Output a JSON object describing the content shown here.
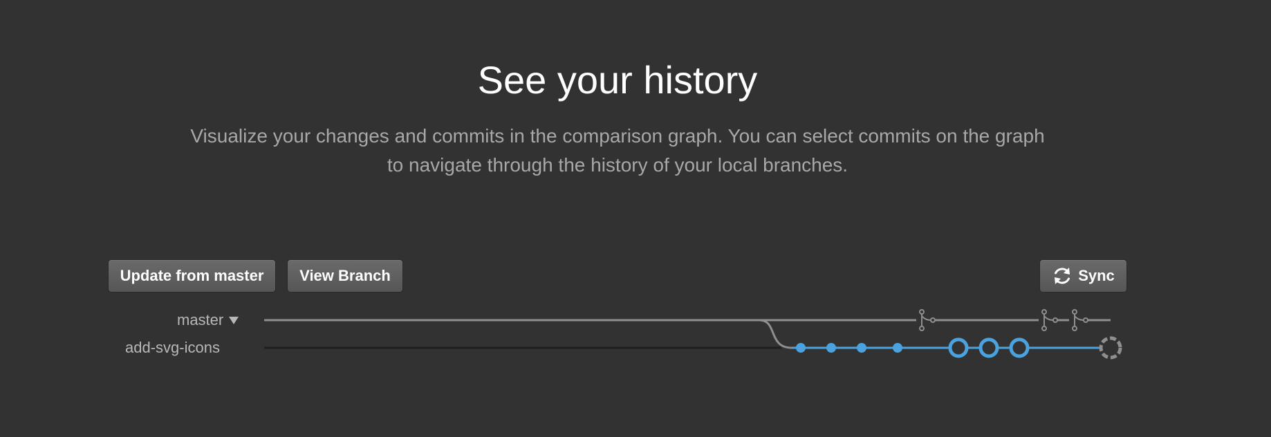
{
  "hero": {
    "title": "See your history",
    "subtitle": "Visualize your changes and commits in the comparison graph. You can select commits on the graph to navigate through the history of your local branches."
  },
  "toolbar": {
    "update_label": "Update from master",
    "view_branch_label": "View Branch",
    "sync_label": "Sync",
    "sync_icon": "sync-icon"
  },
  "branches": {
    "master": {
      "label": "master",
      "dropdown_icon": "caret-down-icon"
    },
    "feature": {
      "label": "add-svg-icons"
    }
  },
  "colors": {
    "background": "#323232",
    "master_line": "#8f8f8f",
    "branch_line": "#4aa3df",
    "button": "#5e5e5e"
  }
}
